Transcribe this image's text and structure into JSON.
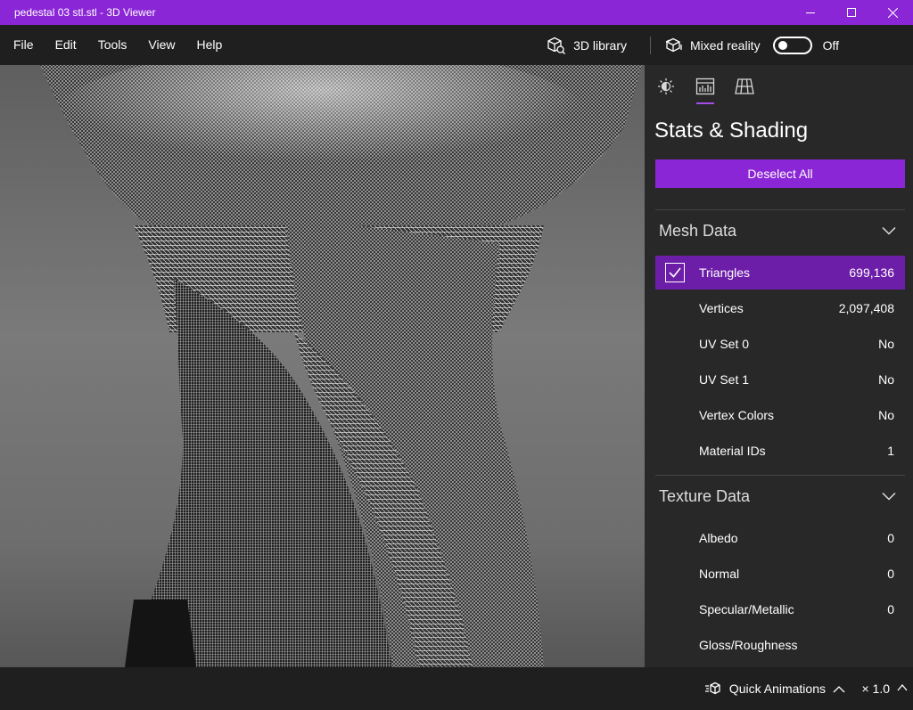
{
  "window": {
    "title": "pedestal 03 stl.stl - 3D Viewer",
    "accent": "#8b26d6"
  },
  "menu": [
    "File",
    "Edit",
    "Tools",
    "View",
    "Help"
  ],
  "toolbar": {
    "library_label": "3D library",
    "mixed_reality_label": "Mixed reality",
    "mixed_reality_state": "Off"
  },
  "panel": {
    "title": "Stats & Shading",
    "deselect_label": "Deselect All",
    "tabs": [
      "lighting-icon",
      "stats-icon",
      "grid-icon"
    ],
    "mesh_section": {
      "title": "Mesh Data",
      "rows": [
        {
          "label": "Triangles",
          "value": "699,136",
          "selected": true
        },
        {
          "label": "Vertices",
          "value": "2,097,408"
        },
        {
          "label": "UV Set 0",
          "value": "No"
        },
        {
          "label": "UV Set 1",
          "value": "No"
        },
        {
          "label": "Vertex Colors",
          "value": "No"
        },
        {
          "label": "Material IDs",
          "value": "1"
        }
      ]
    },
    "texture_section": {
      "title": "Texture Data",
      "rows": [
        {
          "label": "Albedo",
          "value": "0"
        },
        {
          "label": "Normal",
          "value": "0"
        },
        {
          "label": "Specular/Metallic",
          "value": "0"
        },
        {
          "label": "Gloss/Roughness",
          "value": ""
        }
      ]
    }
  },
  "bottom": {
    "quick_animations_label": "Quick Animations",
    "speed_label": "× 1.0"
  }
}
